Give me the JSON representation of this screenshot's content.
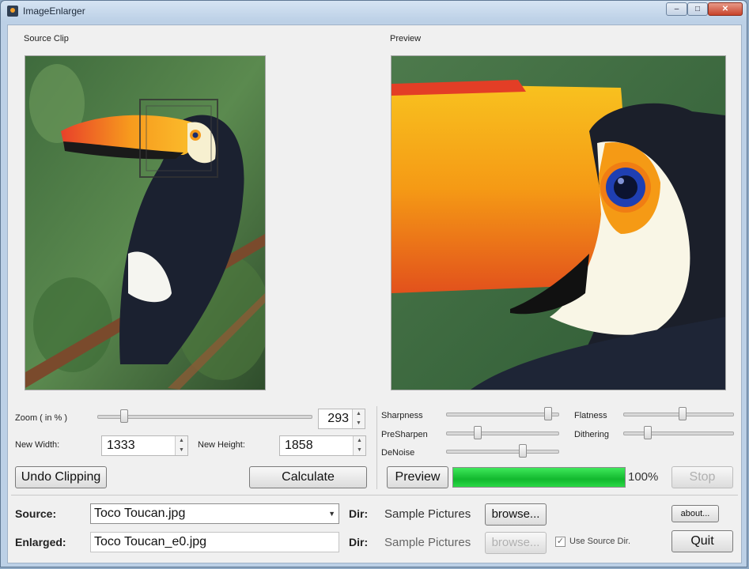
{
  "window": {
    "title": "ImageEnlarger",
    "minimize_glyph": "–",
    "maximize_glyph": "□",
    "close_glyph": "✕"
  },
  "source_clip": {
    "heading": "Source Clip"
  },
  "preview": {
    "heading": "Preview"
  },
  "zoom": {
    "label": "Zoom ( in % )",
    "value": "293",
    "level_fraction": 0.11
  },
  "size": {
    "width_label": "New Width:",
    "width_value": "1333",
    "height_label": "New Height:",
    "height_value": "1858"
  },
  "filters": {
    "sharpness_label": "Sharpness",
    "sharpness_level": 0.95,
    "presharpen_label": "PreSharpen",
    "presharpen_level": 0.27,
    "denoise_label": "DeNoise",
    "denoise_level": 0.7,
    "flatness_label": "Flatness",
    "flatness_level": 0.55,
    "dithering_label": "Dithering",
    "dithering_level": 0.2
  },
  "buttons": {
    "undo_clipping": "Undo Clipping",
    "calculate": "Calculate",
    "preview": "Preview",
    "stop": "Stop",
    "browse": "browse...",
    "browse_disabled": "browse...",
    "about": "about...",
    "quit": "Quit"
  },
  "progress": {
    "percent_text": "100%",
    "fraction": 1.0
  },
  "source": {
    "label": "Source:",
    "file": "Toco Toucan.jpg",
    "dir_label": "Dir:",
    "dir_value": "Sample Pictures"
  },
  "enlarged": {
    "label": "Enlarged:",
    "file": "Toco Toucan_e0.jpg",
    "dir_label": "Dir:",
    "dir_value": "Sample Pictures",
    "use_source_dir_label": "Use Source Dir.",
    "use_source_dir_checked": true
  },
  "icons": {
    "app": "toucan-app-icon",
    "combo": "chevron-down-icon",
    "spin_up": "spin-up-icon",
    "spin_down": "spin-down-icon"
  }
}
